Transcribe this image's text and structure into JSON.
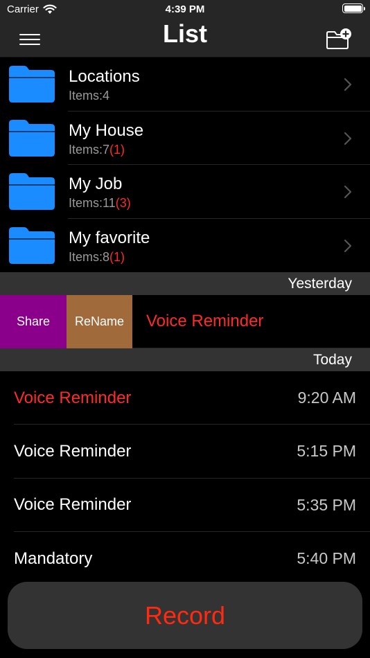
{
  "status_bar": {
    "carrier": "Carrier",
    "time": "4:39 PM",
    "battery_level": 1.0
  },
  "nav": {
    "title": "List",
    "menu_icon": "hamburger-icon",
    "add_icon": "folder-add-icon"
  },
  "folders": [
    {
      "name": "Locations",
      "count_label": "Items:4",
      "unread": ""
    },
    {
      "name": "My House",
      "count_label": "Items:7",
      "unread": "(1)"
    },
    {
      "name": "My Job",
      "count_label": "Items:11",
      "unread": "(3)"
    },
    {
      "name": "My favorite",
      "count_label": "Items:8",
      "unread": "(1)"
    }
  ],
  "sections": {
    "yesterday": {
      "header": "Yesterday",
      "share_label": "Share",
      "rename_label": "ReName",
      "item_title": "Voice Reminder"
    },
    "today": {
      "header": "Today",
      "items": [
        {
          "title": "Voice Reminder",
          "time": "9:20 AM",
          "unread": true
        },
        {
          "title": "Voice Reminder",
          "time": "5:15 PM",
          "unread": false
        },
        {
          "title": "Voice Reminder",
          "time": "5:35 PM",
          "unread": false
        },
        {
          "title": "Mandatory",
          "time": "5:40 PM",
          "unread": false
        }
      ]
    }
  },
  "record_label": "Record",
  "colors": {
    "folder": "#1a8cff",
    "unread": "#ff2a2a",
    "share": "#8b008b",
    "rename": "#a06a3a"
  }
}
